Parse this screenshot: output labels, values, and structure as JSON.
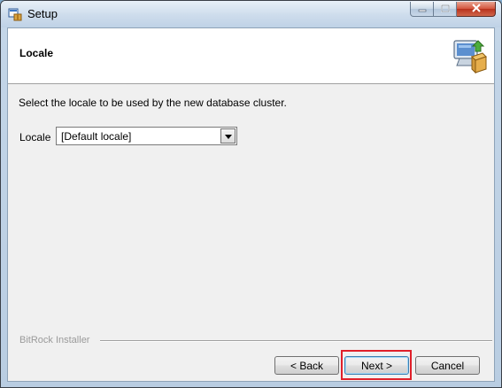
{
  "window": {
    "title": "Setup",
    "icon": "installer-icon",
    "controls": [
      "minimize-icon",
      "maximize-icon",
      "close-icon"
    ]
  },
  "header": {
    "title": "Locale",
    "icon": "computer-package-icon"
  },
  "main": {
    "description": "Select the locale to be used by the new database cluster.",
    "locale_label": "Locale",
    "locale_select": {
      "selected": "[Default locale]"
    }
  },
  "footer": {
    "branding": "BitRock Installer",
    "back_label": "< Back",
    "next_label": "Next >",
    "cancel_label": "Cancel"
  },
  "colors": {
    "highlight": "#e0202a",
    "close_button": "#c9432a"
  }
}
